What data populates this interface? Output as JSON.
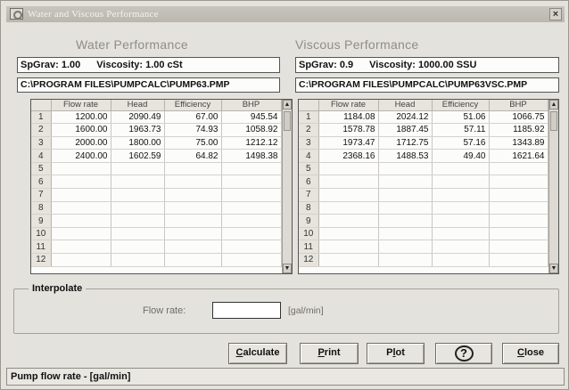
{
  "window": {
    "title": "Water and Viscous Performance",
    "close_glyph": "×"
  },
  "water": {
    "heading": "Water Performance",
    "spgrav": "SpGrav: 1.00",
    "viscosity": "Viscosity: 1.00 cSt",
    "path": "C:\\PROGRAM FILES\\PUMPCALC\\PUMP63.PMP",
    "columns": [
      "Flow rate",
      "Head",
      "Efficiency",
      "BHP"
    ],
    "rows": [
      [
        "1200.00",
        "2090.49",
        "67.00",
        "945.54"
      ],
      [
        "1600.00",
        "1963.73",
        "74.93",
        "1058.92"
      ],
      [
        "2000.00",
        "1800.00",
        "75.00",
        "1212.12"
      ],
      [
        "2400.00",
        "1602.59",
        "64.82",
        "1498.38"
      ],
      [
        "",
        "",
        "",
        ""
      ],
      [
        "",
        "",
        "",
        ""
      ],
      [
        "",
        "",
        "",
        ""
      ],
      [
        "",
        "",
        "",
        ""
      ],
      [
        "",
        "",
        "",
        ""
      ],
      [
        "",
        "",
        "",
        ""
      ],
      [
        "",
        "",
        "",
        ""
      ],
      [
        "",
        "",
        "",
        ""
      ]
    ]
  },
  "viscous": {
    "heading": "Viscous Performance",
    "spgrav": "SpGrav: 0.9",
    "viscosity": "Viscosity: 1000.00 SSU",
    "path": "C:\\PROGRAM FILES\\PUMPCALC\\PUMP63VSC.PMP",
    "columns": [
      "Flow rate",
      "Head",
      "Efficiency",
      "BHP"
    ],
    "rows": [
      [
        "1184.08",
        "2024.12",
        "51.06",
        "1066.75"
      ],
      [
        "1578.78",
        "1887.45",
        "57.11",
        "1185.92"
      ],
      [
        "1973.47",
        "1712.75",
        "57.16",
        "1343.89"
      ],
      [
        "2368.16",
        "1488.53",
        "49.40",
        "1621.64"
      ],
      [
        "",
        "",
        "",
        ""
      ],
      [
        "",
        "",
        "",
        ""
      ],
      [
        "",
        "",
        "",
        ""
      ],
      [
        "",
        "",
        "",
        ""
      ],
      [
        "",
        "",
        "",
        ""
      ],
      [
        "",
        "",
        "",
        ""
      ],
      [
        "",
        "",
        "",
        ""
      ],
      [
        "",
        "",
        "",
        ""
      ]
    ]
  },
  "interpolate": {
    "legend": "Interpolate",
    "flow_label": "Flow rate:",
    "flow_value": "",
    "unit": "[gal/min]"
  },
  "buttons": {
    "calculate_mnemonic": "C",
    "calculate_rest": "alculate",
    "print_mnemonic": "P",
    "print_rest": "rint",
    "plot_pre": "P",
    "plot_mnemonic": "l",
    "plot_post": "ot",
    "help_label": "?",
    "close_mnemonic": "C",
    "close_rest": "lose"
  },
  "status": "Pump flow rate - [gal/min]",
  "icons": {
    "app": "pump-app-icon",
    "close": "close-icon",
    "scroll_up": "arrow-up-icon",
    "scroll_down": "arrow-down-icon",
    "help": "help-icon"
  }
}
